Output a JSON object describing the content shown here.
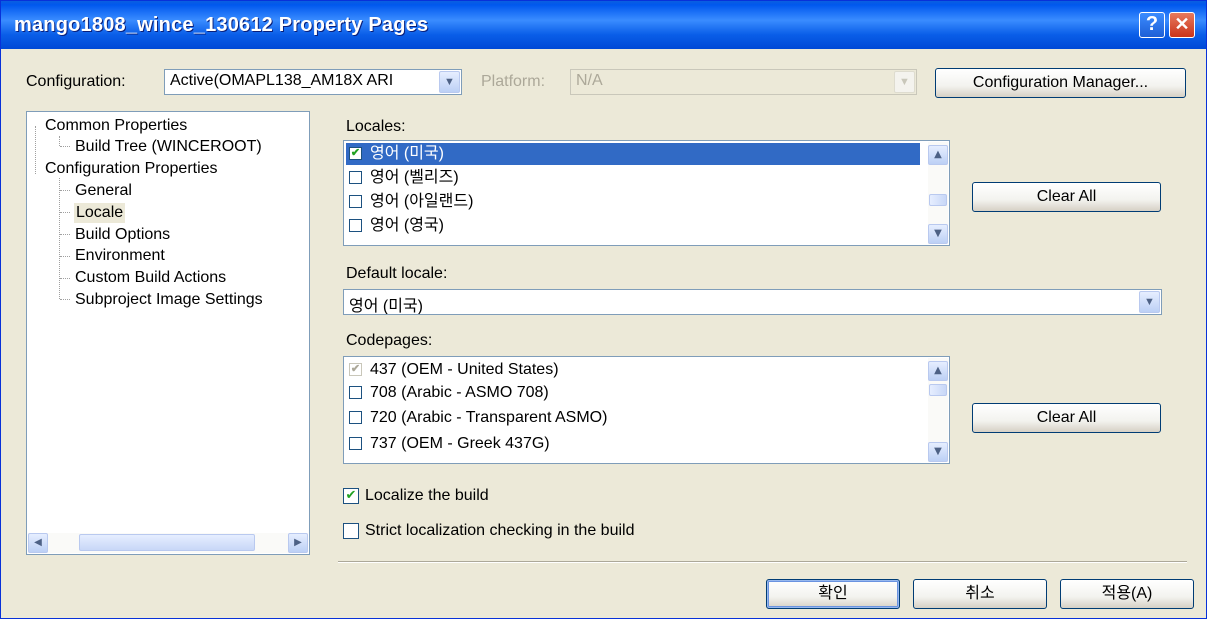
{
  "window": {
    "title": "mango1808_wince_130612 Property Pages",
    "help_glyph": "?",
    "close_glyph": "✕"
  },
  "config": {
    "configuration_label": "Configuration:",
    "configuration_value": "Active(OMAPL138_AM18X ARI",
    "platform_label": "Platform:",
    "platform_value": "N/A",
    "config_manager_button": "Configuration Manager..."
  },
  "tree": {
    "items": [
      {
        "label": "Common Properties"
      },
      {
        "label": "Build Tree (WINCEROOT)"
      },
      {
        "label": "Configuration Properties"
      },
      {
        "label": "General"
      },
      {
        "label": "Locale"
      },
      {
        "label": "Build Options"
      },
      {
        "label": "Environment"
      },
      {
        "label": "Custom Build Actions"
      },
      {
        "label": "Subproject Image Settings"
      }
    ],
    "scroll_left": "◀",
    "scroll_right": "▶"
  },
  "locales": {
    "label": "Locales:",
    "items": [
      {
        "label": "영어 (미국)",
        "checked": true,
        "selected": true
      },
      {
        "label": "영어 (벨리즈)",
        "checked": false
      },
      {
        "label": "영어 (아일랜드)",
        "checked": false
      },
      {
        "label": "영어 (영국)",
        "checked": false
      }
    ],
    "clear_all": "Clear All"
  },
  "default_locale": {
    "label": "Default locale:",
    "value": "영어 (미국)"
  },
  "codepages": {
    "label": "Codepages:",
    "items": [
      {
        "label": "437  (OEM - United States)",
        "checked": true,
        "disabled": true
      },
      {
        "label": "708  (Arabic - ASMO 708)",
        "checked": false
      },
      {
        "label": "720  (Arabic - Transparent ASMO)",
        "checked": false
      },
      {
        "label": "737  (OEM - Greek 437G)",
        "checked": false
      }
    ],
    "clear_all": "Clear All"
  },
  "options": {
    "localize_build": {
      "label": "Localize the build",
      "checked": true
    },
    "strict_localization": {
      "label": "Strict localization checking in the build",
      "checked": false
    }
  },
  "footer": {
    "ok": "확인",
    "cancel": "취소",
    "apply": "적용(A)"
  },
  "icons": {
    "check": "✔",
    "arrow_down": "▼",
    "arrow_up": "▲"
  }
}
